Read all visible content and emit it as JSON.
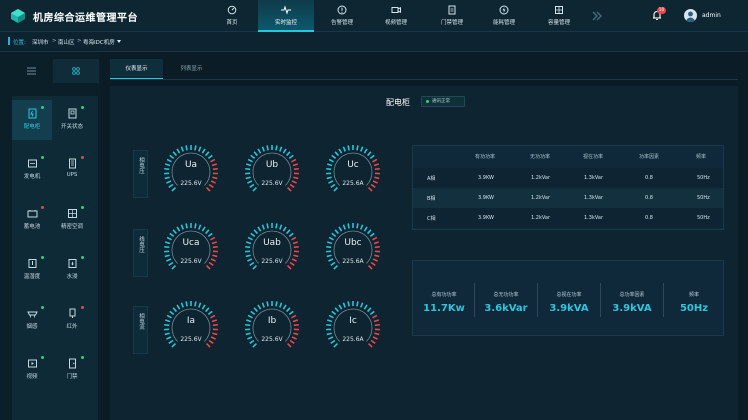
{
  "header": {
    "title": "机房综合运维管理平台",
    "nav": [
      {
        "label": "首页",
        "icon": "home-icon"
      },
      {
        "label": "实时监控",
        "icon": "pulse-icon",
        "active": true
      },
      {
        "label": "告警管理",
        "icon": "alert-icon"
      },
      {
        "label": "视频管理",
        "icon": "video-icon"
      },
      {
        "label": "门禁管理",
        "icon": "door-icon"
      },
      {
        "label": "能耗管理",
        "icon": "energy-icon"
      },
      {
        "label": "容量管理",
        "icon": "capacity-icon"
      }
    ],
    "notification_count": "10",
    "user": "admin"
  },
  "breadcrumb": {
    "label": "位置:",
    "items": [
      "深圳市",
      "南山区",
      "粤海IDC机房"
    ]
  },
  "sidebar": {
    "items": [
      {
        "label": "配电柜",
        "icon": "cabinet-icon",
        "active": true,
        "dot": "#2ed47a"
      },
      {
        "label": "开关状态",
        "icon": "switch-icon",
        "dot": "#2ed47a"
      },
      {
        "label": "发电机",
        "icon": "generator-icon",
        "dot": "#2ed47a"
      },
      {
        "label": "UPS",
        "icon": "ups-icon",
        "dot": "#e9474b"
      },
      {
        "label": "蓄电池",
        "icon": "battery-icon",
        "dot": "#e9474b"
      },
      {
        "label": "精密空调",
        "icon": "aircon-icon",
        "dot": "#2ed47a"
      },
      {
        "label": "温湿度",
        "icon": "thermometer-icon",
        "dot": "#2ed47a"
      },
      {
        "label": "水浸",
        "icon": "water-icon",
        "dot": "#2ed47a"
      },
      {
        "label": "烟感",
        "icon": "smoke-icon",
        "dot": "#2ed47a"
      },
      {
        "label": "红外",
        "icon": "infrared-icon",
        "dot": "#e9474b"
      },
      {
        "label": "视频",
        "icon": "camera-icon",
        "dot": "#2ed47a"
      },
      {
        "label": "门禁",
        "icon": "lock-icon",
        "dot": "#2ed47a"
      }
    ]
  },
  "tabs": [
    {
      "label": "仪表显示",
      "active": true
    },
    {
      "label": "列表显示"
    }
  ],
  "panel": {
    "title": "配电柜",
    "status": "通讯正常",
    "row_labels": [
      "相电压",
      "线电压",
      "相电流"
    ],
    "gauges": [
      [
        {
          "name": "Ua",
          "value": "225.6V",
          "level": 0.72
        },
        {
          "name": "Ub",
          "value": "225.6V",
          "level": 0.72
        },
        {
          "name": "Uc",
          "value": "225.6A",
          "level": 0.72
        }
      ],
      [
        {
          "name": "Uca",
          "value": "225.6V",
          "level": 0.72
        },
        {
          "name": "Uab",
          "value": "225.6V",
          "level": 0.72
        },
        {
          "name": "Ubc",
          "value": "225.6A",
          "level": 0.72
        }
      ],
      [
        {
          "name": "Ia",
          "value": "225.6V",
          "level": 0.72
        },
        {
          "name": "Ib",
          "value": "225.6V",
          "level": 0.72
        },
        {
          "name": "Ic",
          "value": "225.6A",
          "level": 0.72
        }
      ]
    ],
    "table": {
      "headers": [
        "有功功率",
        "无功功率",
        "视在功率",
        "功率因素",
        "频率"
      ],
      "rows": [
        {
          "phase": "A相",
          "cells": [
            "3.9KW",
            "1.2kVar",
            "1.3kVar",
            "0.8",
            "50Hz"
          ]
        },
        {
          "phase": "B相",
          "cells": [
            "3.9KW",
            "1.2kVar",
            "1.3kVar",
            "0.8",
            "50Hz"
          ]
        },
        {
          "phase": "C相",
          "cells": [
            "3.9KW",
            "1.2kVar",
            "1.3kVar",
            "0.8",
            "50Hz"
          ]
        }
      ]
    },
    "summary": [
      {
        "label": "总有功功率",
        "value": "11.7Kw"
      },
      {
        "label": "总无功功率",
        "value": "3.6kVar"
      },
      {
        "label": "总视在功率",
        "value": "3.9kVA"
      },
      {
        "label": "总功率因素",
        "value": "3.9kVA"
      },
      {
        "label": "频率",
        "value": "50Hz"
      }
    ]
  },
  "colors": {
    "accent": "#29c3d8",
    "alarm": "#e9474b",
    "ok": "#2ed47a"
  }
}
